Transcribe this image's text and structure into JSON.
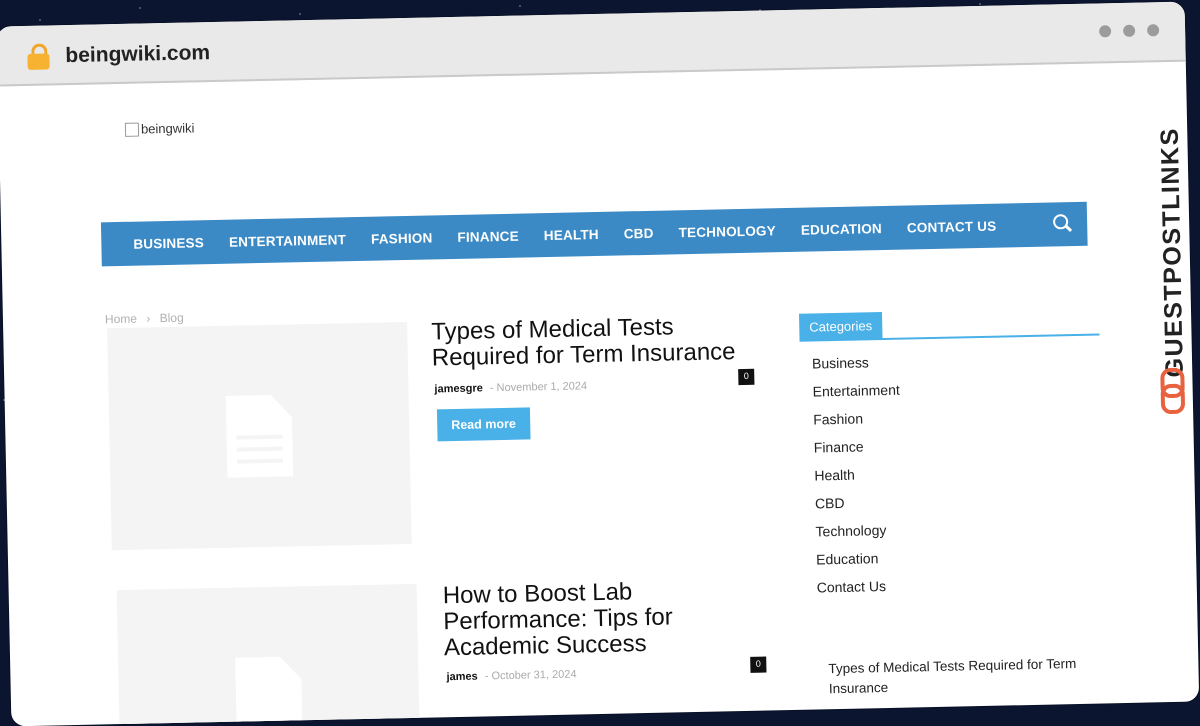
{
  "browser": {
    "url": "beingwiki.com"
  },
  "site": {
    "logo_alt": "beingwiki"
  },
  "nav": {
    "items": [
      "BUSINESS",
      "ENTERTAINMENT",
      "FASHION",
      "FINANCE",
      "HEALTH",
      "CBD",
      "TECHNOLOGY",
      "EDUCATION",
      "CONTACT US"
    ]
  },
  "breadcrumb": {
    "home": "Home",
    "separator": "›",
    "current": "Blog"
  },
  "posts": [
    {
      "title_line1": "Types of Medical Tests",
      "title_line2": "Required for Term Insurance",
      "author": "jamesgre",
      "dash": "-",
      "date": "November 1, 2024",
      "comments": "0",
      "read_more": "Read more"
    },
    {
      "title_line1": "How to Boost Lab",
      "title_line2": "Performance: Tips for",
      "title_line3": "Academic Success",
      "author": "james",
      "dash": "-",
      "date": "October 31, 2024",
      "comments": "0"
    }
  ],
  "sidebar": {
    "heading": "Categories",
    "categories": [
      "Business",
      "Entertainment",
      "Fashion",
      "Finance",
      "Health",
      "CBD",
      "Technology",
      "Education",
      "Contact Us"
    ],
    "recent_post": "Types of Medical Tests Required for Term Insurance"
  },
  "watermark": {
    "text": "GUESTPOSTLINKS",
    "icon": "chain-link-icon",
    "color": "#e8623f"
  },
  "colors": {
    "nav": "#3b8ac6",
    "accent": "#49b0e8"
  }
}
